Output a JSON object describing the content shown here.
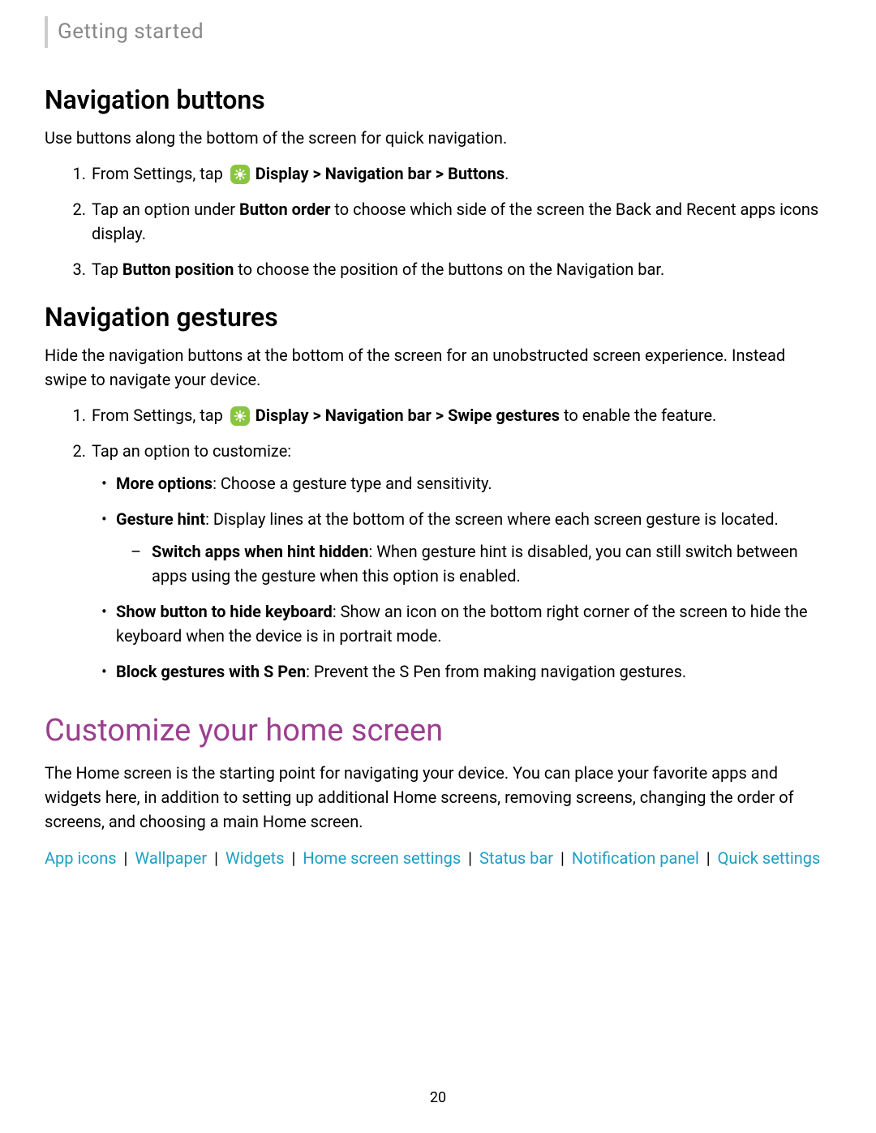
{
  "header": {
    "breadcrumb": "Getting started"
  },
  "nav_buttons": {
    "title": "Navigation buttons",
    "intro": "Use buttons along the bottom of the screen for quick navigation.",
    "step1_pre": "From Settings, tap ",
    "step1_path": "Display > Navigation bar > Buttons",
    "step1_end": ".",
    "step2_pre": "Tap an option under ",
    "step2_bold": "Button order",
    "step2_rest": " to choose which side of the screen the Back and Recent apps icons display.",
    "step3_pre": "Tap ",
    "step3_bold": "Button position",
    "step3_rest": " to choose the position of the buttons on the Navigation bar."
  },
  "nav_gestures": {
    "title": "Navigation gestures",
    "intro": "Hide the navigation buttons at the bottom of the screen for an unobstructed screen experience. Instead swipe to navigate your device.",
    "step1_pre": "From Settings, tap ",
    "step1_path": "Display > Navigation bar > Swipe gestures",
    "step1_rest": " to enable the feature.",
    "step2": "Tap an option to customize:",
    "more_options_bold": "More options",
    "more_options_rest": ": Choose a gesture type and sensitivity.",
    "gesture_hint_bold": "Gesture hint",
    "gesture_hint_rest": ": Display lines at the bottom of the screen where each screen gesture is located.",
    "switch_apps_bold": "Switch apps when hint hidden",
    "switch_apps_rest": ": When gesture hint is disabled, you can still switch between apps using the gesture when this option is enabled.",
    "show_button_bold": "Show button to hide keyboard",
    "show_button_rest": ": Show an icon on the bottom right corner of the screen to hide the keyboard when the device is in portrait mode.",
    "block_spen_bold": "Block gestures with S Pen",
    "block_spen_rest": ": Prevent the S Pen from making navigation gestures."
  },
  "customize": {
    "title": "Customize your home screen",
    "intro": "The Home screen is the starting point for navigating your device. You can place your favorite apps and widgets here, in addition to setting up additional Home screens, removing screens, changing the order of screens, and choosing a main Home screen.",
    "links": [
      "App icons",
      "Wallpaper",
      "Widgets",
      "Home screen settings",
      "Status bar",
      "Notification panel",
      "Quick settings"
    ],
    "sep": " | "
  },
  "page_number": "20"
}
